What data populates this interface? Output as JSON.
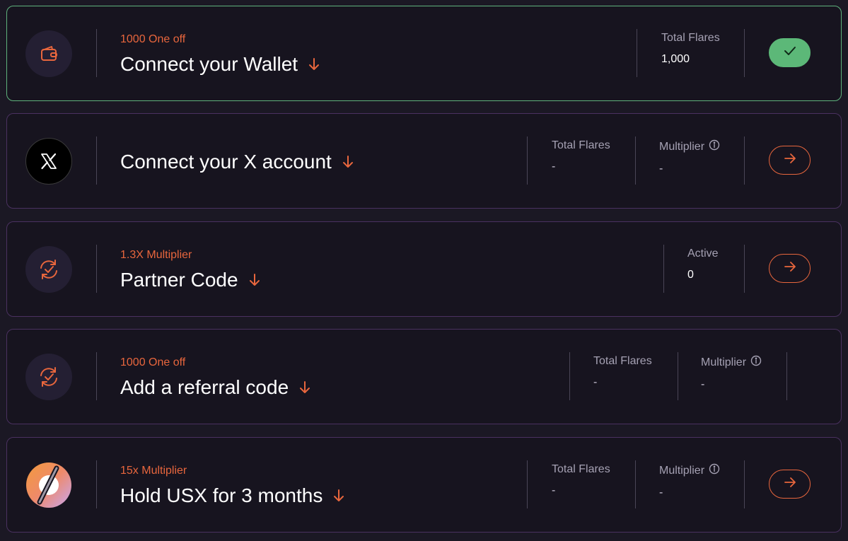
{
  "colors": {
    "accent": "#e8663d",
    "success": "#5cb878",
    "card_border": "#4a3160",
    "card_border_done": "#5fb37d",
    "background": "#1b1824"
  },
  "tasks": [
    {
      "icon": "wallet-icon",
      "tag": "1000 One off",
      "title": "Connect your Wallet",
      "stats": [
        {
          "label": "Total Flares",
          "value": "1,000"
        }
      ],
      "action": "completed-check"
    },
    {
      "icon": "x-logo-icon",
      "tag": "",
      "title": "Connect your X account",
      "stats": [
        {
          "label": "Total Flares",
          "value": "-"
        },
        {
          "label": "Multiplier",
          "value": "-"
        }
      ],
      "action": "arrow-right"
    },
    {
      "icon": "refresh-check-icon",
      "tag": "1.3X Multiplier",
      "title": "Partner Code",
      "stats": [
        {
          "label": "Active",
          "value": "0"
        }
      ],
      "action": "arrow-right"
    },
    {
      "icon": "refresh-check-icon",
      "tag": "1000 One off",
      "title": "Add a referral code",
      "stats": [
        {
          "label": "Total Flares",
          "value": "-"
        },
        {
          "label": "Multiplier",
          "value": "-"
        }
      ],
      "action": ""
    },
    {
      "icon": "usx-logo-icon",
      "tag": "15x Multiplier",
      "title": "Hold USX for 3 months",
      "stats": [
        {
          "label": "Total Flares",
          "value": "-"
        },
        {
          "label": "Multiplier",
          "value": "-"
        }
      ],
      "action": "arrow-right"
    }
  ]
}
